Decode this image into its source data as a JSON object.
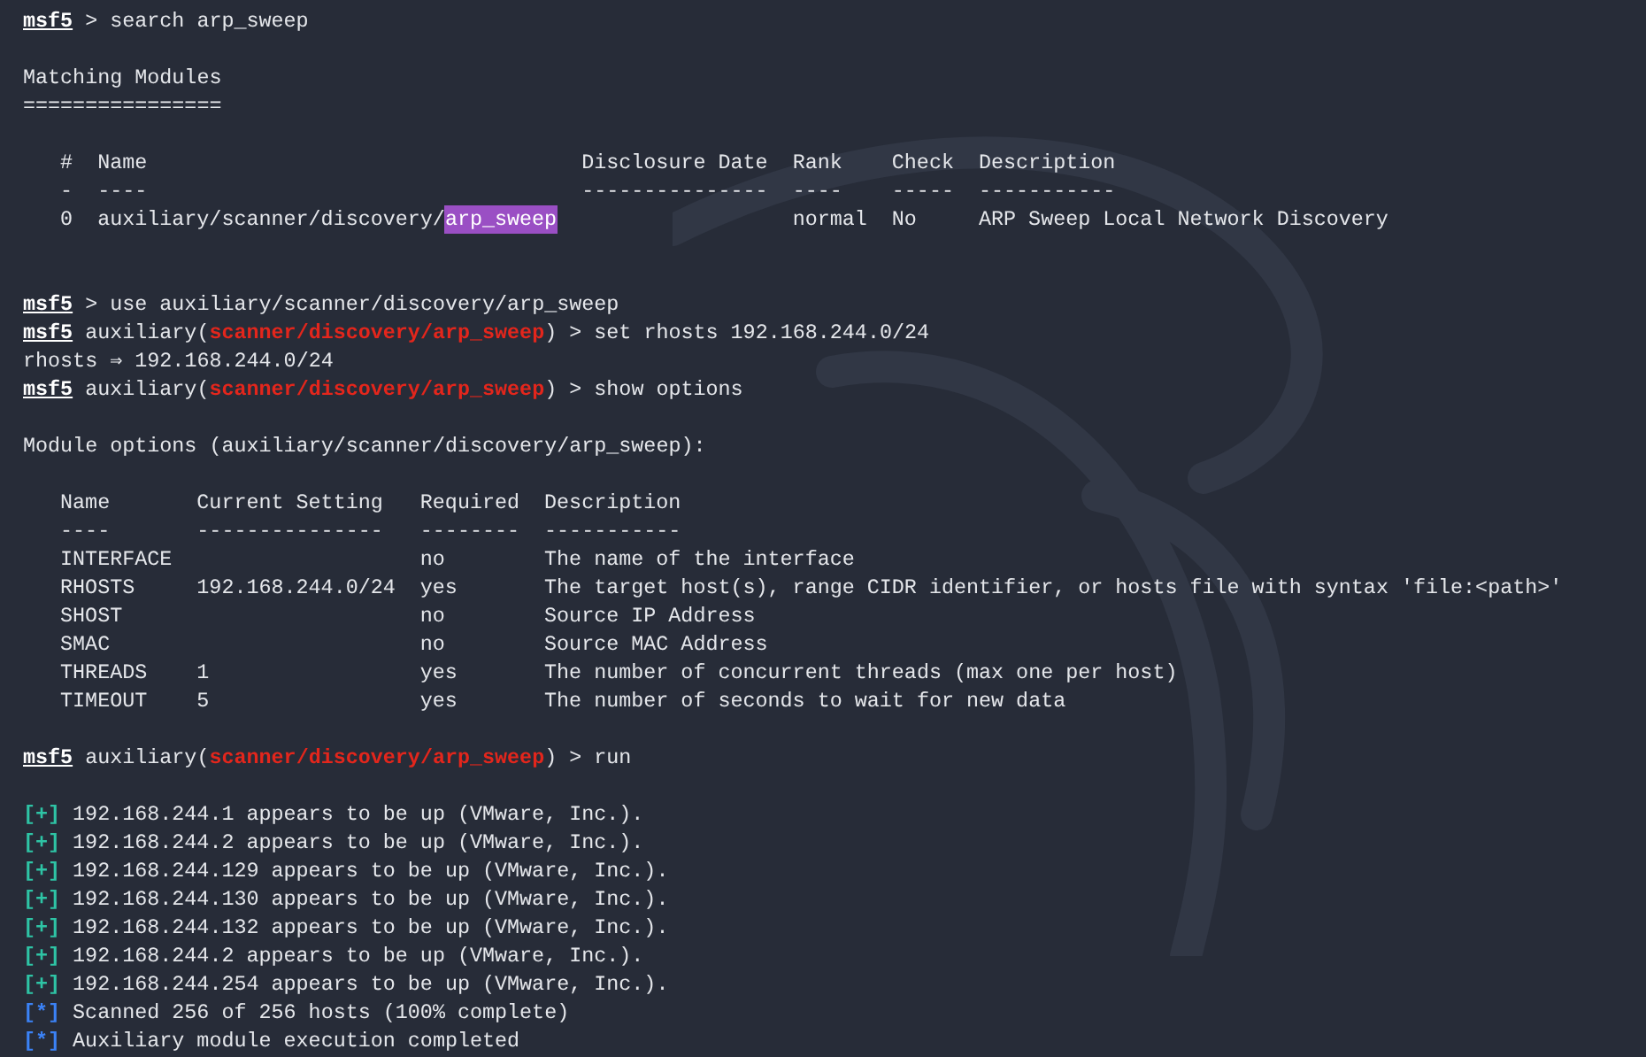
{
  "lines": [
    {
      "kind": "text",
      "segments": [
        {
          "kind": "prompt",
          "text": "msf5"
        },
        {
          "kind": "plain",
          "text": " > search arp_sweep"
        }
      ]
    },
    {
      "kind": "blank"
    },
    {
      "kind": "text",
      "segments": [
        {
          "kind": "plain",
          "text": "Matching Modules"
        }
      ]
    },
    {
      "kind": "text",
      "segments": [
        {
          "kind": "plain",
          "text": "================"
        }
      ]
    },
    {
      "kind": "blank"
    },
    {
      "kind": "module_table",
      "columns": [
        {
          "label": "#",
          "rule": "-"
        },
        {
          "label": "Name",
          "rule": "----"
        },
        {
          "label": "Disclosure Date",
          "rule": "---------------"
        },
        {
          "label": "Rank",
          "rule": "----"
        },
        {
          "label": "Check",
          "rule": "-----"
        },
        {
          "label": "Description",
          "rule": "-----------"
        }
      ],
      "rows": [
        [
          "0",
          [
            {
              "kind": "plain",
              "text": "auxiliary/scanner/discovery/"
            },
            {
              "kind": "match",
              "text": "arp_sweep"
            }
          ],
          "",
          "normal",
          "No",
          "ARP Sweep Local Network Discovery"
        ]
      ]
    },
    {
      "kind": "blank"
    },
    {
      "kind": "blank"
    },
    {
      "kind": "text",
      "segments": [
        {
          "kind": "prompt",
          "text": "msf5"
        },
        {
          "kind": "plain",
          "text": " > use auxiliary/scanner/discovery/arp_sweep"
        }
      ]
    },
    {
      "kind": "text",
      "segments": [
        {
          "kind": "prompt",
          "text": "msf5"
        },
        {
          "kind": "plain",
          "text": " auxiliary("
        },
        {
          "kind": "module",
          "text": "scanner/discovery/arp_sweep"
        },
        {
          "kind": "plain",
          "text": ") > set rhosts 192.168.244.0/24"
        }
      ]
    },
    {
      "kind": "text",
      "segments": [
        {
          "kind": "plain",
          "text": "rhosts ⇒ 192.168.244.0/24"
        }
      ]
    },
    {
      "kind": "text",
      "segments": [
        {
          "kind": "prompt",
          "text": "msf5"
        },
        {
          "kind": "plain",
          "text": " auxiliary("
        },
        {
          "kind": "module",
          "text": "scanner/discovery/arp_sweep"
        },
        {
          "kind": "plain",
          "text": ") > show options"
        }
      ]
    },
    {
      "kind": "blank"
    },
    {
      "kind": "text",
      "segments": [
        {
          "kind": "plain",
          "text": "Module options (auxiliary/scanner/discovery/arp_sweep):"
        }
      ]
    },
    {
      "kind": "blank"
    },
    {
      "kind": "options_table",
      "columns": [
        {
          "label": "Name",
          "rule": "----"
        },
        {
          "label": "Current Setting",
          "rule": "---------------"
        },
        {
          "label": "Required",
          "rule": "--------"
        },
        {
          "label": "Description",
          "rule": "-----------"
        }
      ],
      "rows": [
        [
          "INTERFACE",
          "",
          "no",
          "The name of the interface"
        ],
        [
          "RHOSTS",
          "192.168.244.0/24",
          "yes",
          "The target host(s), range CIDR identifier, or hosts file with syntax 'file:<path>'"
        ],
        [
          "SHOST",
          "",
          "no",
          "Source IP Address"
        ],
        [
          "SMAC",
          "",
          "no",
          "Source MAC Address"
        ],
        [
          "THREADS",
          "1",
          "yes",
          "The number of concurrent threads (max one per host)"
        ],
        [
          "TIMEOUT",
          "5",
          "yes",
          "The number of seconds to wait for new data"
        ]
      ]
    },
    {
      "kind": "blank"
    },
    {
      "kind": "text",
      "segments": [
        {
          "kind": "prompt",
          "text": "msf5"
        },
        {
          "kind": "plain",
          "text": " auxiliary("
        },
        {
          "kind": "module",
          "text": "scanner/discovery/arp_sweep"
        },
        {
          "kind": "plain",
          "text": ") > run"
        }
      ]
    },
    {
      "kind": "blank"
    },
    {
      "kind": "status",
      "mark": "[+]",
      "color": "#2ec4a5",
      "text": "192.168.244.1 appears to be up (VMware, Inc.)."
    },
    {
      "kind": "status",
      "mark": "[+]",
      "color": "#2ec4a5",
      "text": "192.168.244.2 appears to be up (VMware, Inc.)."
    },
    {
      "kind": "status",
      "mark": "[+]",
      "color": "#2ec4a5",
      "text": "192.168.244.129 appears to be up (VMware, Inc.)."
    },
    {
      "kind": "status",
      "mark": "[+]",
      "color": "#2ec4a5",
      "text": "192.168.244.130 appears to be up (VMware, Inc.)."
    },
    {
      "kind": "status",
      "mark": "[+]",
      "color": "#2ec4a5",
      "text": "192.168.244.132 appears to be up (VMware, Inc.)."
    },
    {
      "kind": "status",
      "mark": "[+]",
      "color": "#2ec4a5",
      "text": "192.168.244.2 appears to be up (VMware, Inc.)."
    },
    {
      "kind": "status",
      "mark": "[+]",
      "color": "#2ec4a5",
      "text": "192.168.244.254 appears to be up (VMware, Inc.)."
    },
    {
      "kind": "status",
      "mark": "[*]",
      "color": "#3b82f6",
      "text": "Scanned 256 of 256 hosts (100% complete)"
    },
    {
      "kind": "status",
      "mark": "[*]",
      "color": "#3b82f6",
      "text": "Auxiliary module execution completed"
    }
  ]
}
